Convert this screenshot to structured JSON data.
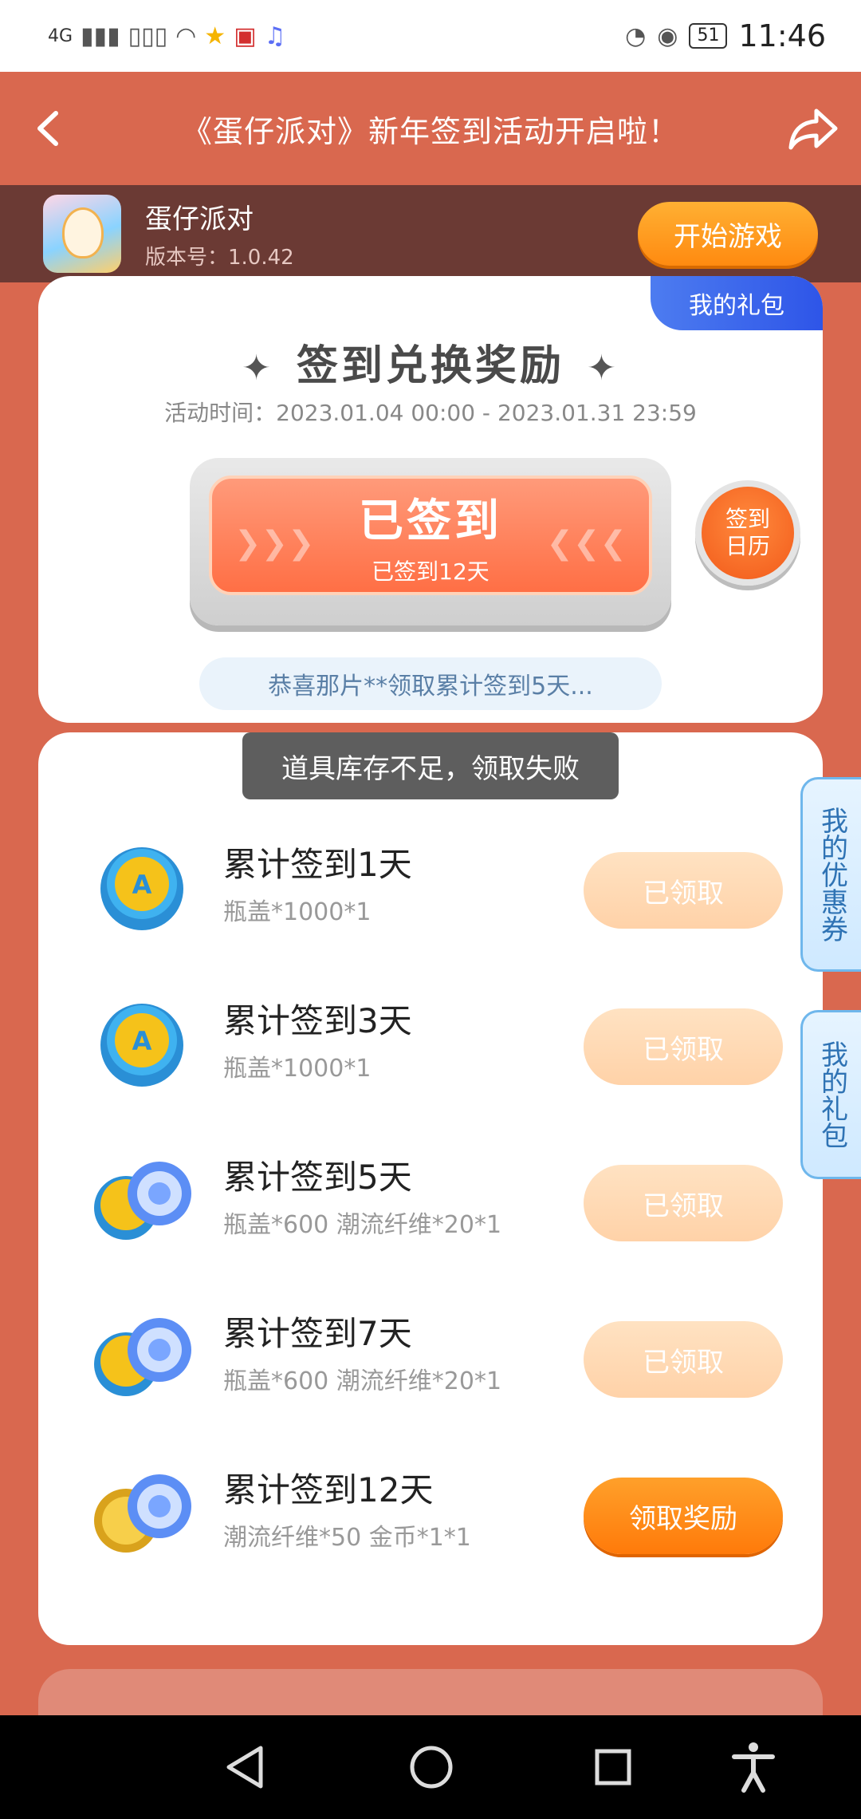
{
  "status_bar": {
    "network": "4G",
    "battery": "51",
    "time": "11:46"
  },
  "header": {
    "title": "《蛋仔派对》新年签到活动开启啦！"
  },
  "game": {
    "name": "蛋仔派对",
    "version": "版本号：1.0.42",
    "play_label": "开始游戏"
  },
  "checkin": {
    "my_gift_tab": "我的礼包",
    "heading": "签到兑换奖励",
    "activity_time": "活动时间：2023.01.04 00:00 - 2023.01.31 23:59",
    "button_title": "已签到",
    "button_sub": "已签到12天",
    "calendar_line1": "签到",
    "calendar_line2": "日历",
    "congrats": "恭喜那片**领取累计签到5天..."
  },
  "toast": "道具库存不足，领取失败",
  "rewards": [
    {
      "title": "累计签到1天",
      "desc": "瓶盖*1000*1",
      "button": "已领取",
      "state": "claimed",
      "icon": "bottle-cap-icon"
    },
    {
      "title": "累计签到3天",
      "desc": "瓶盖*1000*1",
      "button": "已领取",
      "state": "claimed",
      "icon": "bottle-cap-icon"
    },
    {
      "title": "累计签到5天",
      "desc": "瓶盖*600 潮流纤维*20*1",
      "button": "已领取",
      "state": "claimed",
      "icon": "cap-and-fiber-icon"
    },
    {
      "title": "累计签到7天",
      "desc": "瓶盖*600 潮流纤维*20*1",
      "button": "已领取",
      "state": "claimed",
      "icon": "cap-and-fiber-icon"
    },
    {
      "title": "累计签到12天",
      "desc": "潮流纤维*50 金币*1*1",
      "button": "领取奖励",
      "state": "active",
      "icon": "coin-and-fiber-icon"
    }
  ],
  "side_tabs": {
    "coupons": "我的优惠券",
    "gifts": "我的礼包"
  },
  "colors": {
    "background": "#d9684f",
    "accent_orange": "#ff7a0a",
    "claimed_button": "#ffd2a8",
    "blue_tab": "#2e55e8"
  }
}
